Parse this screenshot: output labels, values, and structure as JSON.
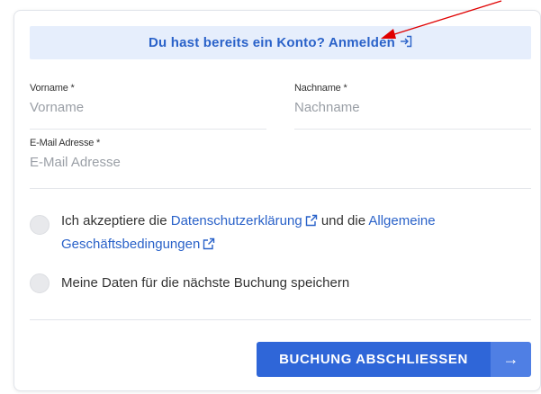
{
  "login_banner": {
    "text": "Du hast bereits ein Konto? Anmelden",
    "icon": "login-icon"
  },
  "form": {
    "first_name": {
      "label": "Vorname *",
      "placeholder": "Vorname"
    },
    "last_name": {
      "label": "Nachname *",
      "placeholder": "Nachname"
    },
    "email": {
      "label": "E-Mail Adresse *",
      "placeholder": "E-Mail Adresse"
    }
  },
  "consent": {
    "prefix": "Ich akzeptiere die ",
    "privacy_link": "Datenschutzerklärung",
    "middle": " und die ",
    "terms_link_line1": "Allgemeine",
    "terms_link_line2": "Geschäftsbedingungen",
    "checked": false
  },
  "save_data": {
    "label": "Meine Daten für die nächste Buchung speichern",
    "checked": false
  },
  "submit": {
    "label": "BUCHUNG ABSCHLIESSEN",
    "arrow": "→"
  },
  "colors": {
    "accent": "#2f66d8",
    "link": "#2a62c9",
    "banner_bg": "#e6eefc",
    "annotation_arrow": "#e00000"
  }
}
